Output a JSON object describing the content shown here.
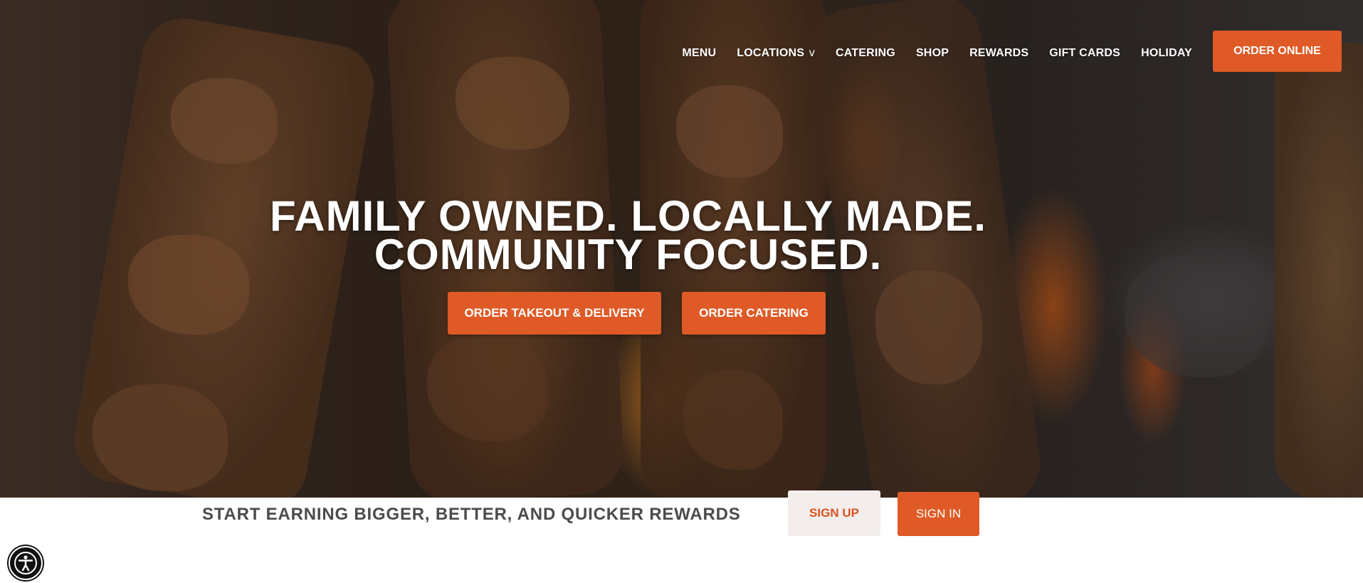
{
  "nav": {
    "items": [
      {
        "label": "MENU"
      },
      {
        "label": "LOCATIONS",
        "caret": "v"
      },
      {
        "label": "CATERING"
      },
      {
        "label": "SHOP"
      },
      {
        "label": "REWARDS"
      },
      {
        "label": "GIFT CARDS"
      },
      {
        "label": "HOLIDAY"
      }
    ],
    "order_online": "ORDER ONLINE"
  },
  "hero": {
    "line1": "FAMILY OWNED. LOCALLY MADE.",
    "line2": "COMMUNITY FOCUSED.",
    "btn_takeout": "ORDER TAKEOUT & DELIVERY",
    "btn_catering": "ORDER CATERING"
  },
  "rewards": {
    "text": "START EARNING BIGGER, BETTER, AND QUICKER REWARDS",
    "signup": "SIGN UP",
    "signin": "SIGN IN"
  },
  "colors": {
    "accent": "#df5a26",
    "signup_bg": "#f3edec",
    "rewards_text": "#4b4b4b"
  },
  "icons": {
    "accessibility": "accessibility-icon"
  }
}
